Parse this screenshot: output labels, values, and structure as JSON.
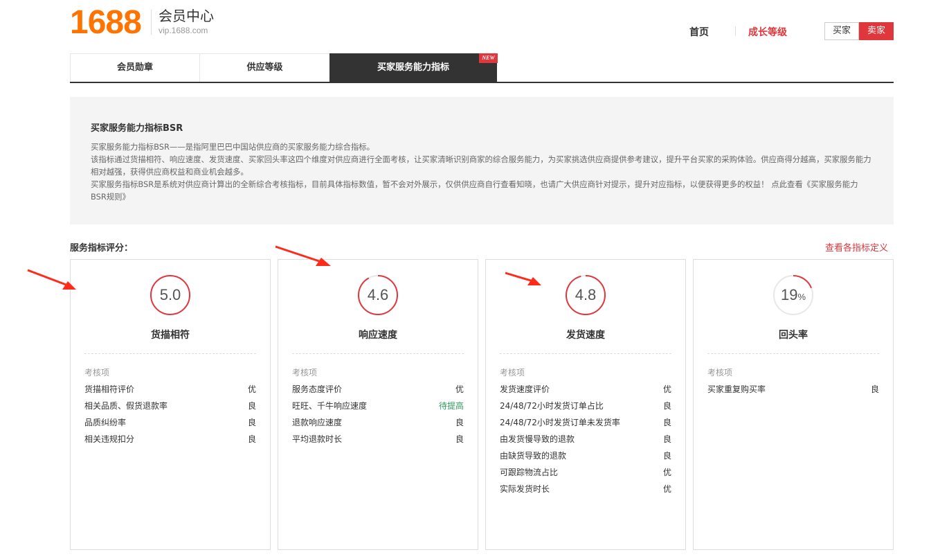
{
  "header": {
    "logo": "1688",
    "title": "会员中心",
    "url": "vip.1688.com",
    "nav": {
      "home": "首页",
      "growth": "成长等级"
    },
    "roles": {
      "buyer": "买家",
      "seller": "卖家"
    }
  },
  "tabs": [
    {
      "label": "会员勋章"
    },
    {
      "label": "供应等级"
    },
    {
      "label": "买家服务能力指标"
    }
  ],
  "tab_badge": "NEW",
  "intro": {
    "title": "买家服务能力指标BSR",
    "p1": "买家服务能力指标BSR——是指阿里巴巴中国站供应商的买家服务能力综合指标。",
    "p2": "该指标通过货描相符、响应速度、发货速度、买家回头率这四个维度对供应商进行全面考核，让买家清晰识别商家的综合服务能力，为买家挑选供应商提供参考建议，提升平台买家的采购体验。供应商得分越高，买家服务能力相对越强，获得供应商权益和商业机会越多。",
    "p3": "买家服务指标BSR是系统对供应商计算出的全新综合考核指标，目前具体指标数值，暂不会对外展示，仅供供应商自行查看知晓，也请广大供应商针对提示，提升对应指标，以便获得更多的权益！ 点此查看《买家服务能力BSR规则》"
  },
  "section": {
    "title": "服务指标评分：",
    "link": "查看各指标定义"
  },
  "cards": [
    {
      "value": "5.0",
      "unit": "",
      "fill": 1.0,
      "title": "货描相符",
      "sub": "考核项",
      "items": [
        {
          "name": "货描相符评价",
          "grade": "优"
        },
        {
          "name": "相关品质、假货退款率",
          "grade": "良"
        },
        {
          "name": "品质纠纷率",
          "grade": "良"
        },
        {
          "name": "相关违规扣分",
          "grade": "良"
        }
      ]
    },
    {
      "value": "4.6",
      "unit": "",
      "fill": 0.92,
      "title": "响应速度",
      "sub": "考核项",
      "items": [
        {
          "name": "服务态度评价",
          "grade": "优"
        },
        {
          "name": "旺旺、千牛响应速度",
          "grade": "待提高"
        },
        {
          "name": "退款响应速度",
          "grade": "良"
        },
        {
          "name": "平均退款时长",
          "grade": "良"
        }
      ]
    },
    {
      "value": "4.8",
      "unit": "",
      "fill": 0.96,
      "title": "发货速度",
      "sub": "考核项",
      "items": [
        {
          "name": "发货速度评价",
          "grade": "优"
        },
        {
          "name": "24/48/72小时发货订单占比",
          "grade": "良"
        },
        {
          "name": "24/48/72小时发货订单未发货率",
          "grade": "良"
        },
        {
          "name": "由发货慢导致的退款",
          "grade": "良"
        },
        {
          "name": "由缺货导致的退款",
          "grade": "良"
        },
        {
          "name": "可跟踪物流占比",
          "grade": "优"
        },
        {
          "name": "实际发货时长",
          "grade": "优"
        }
      ]
    },
    {
      "value": "19",
      "unit": "%",
      "fill": 0.19,
      "title": "回头率",
      "sub": "考核项",
      "items": [
        {
          "name": "买家重复购买率",
          "grade": "良"
        }
      ]
    }
  ],
  "colors": {
    "accent": "#e0373d",
    "brand": "#ff7300",
    "warn": "#2f9c5c"
  }
}
